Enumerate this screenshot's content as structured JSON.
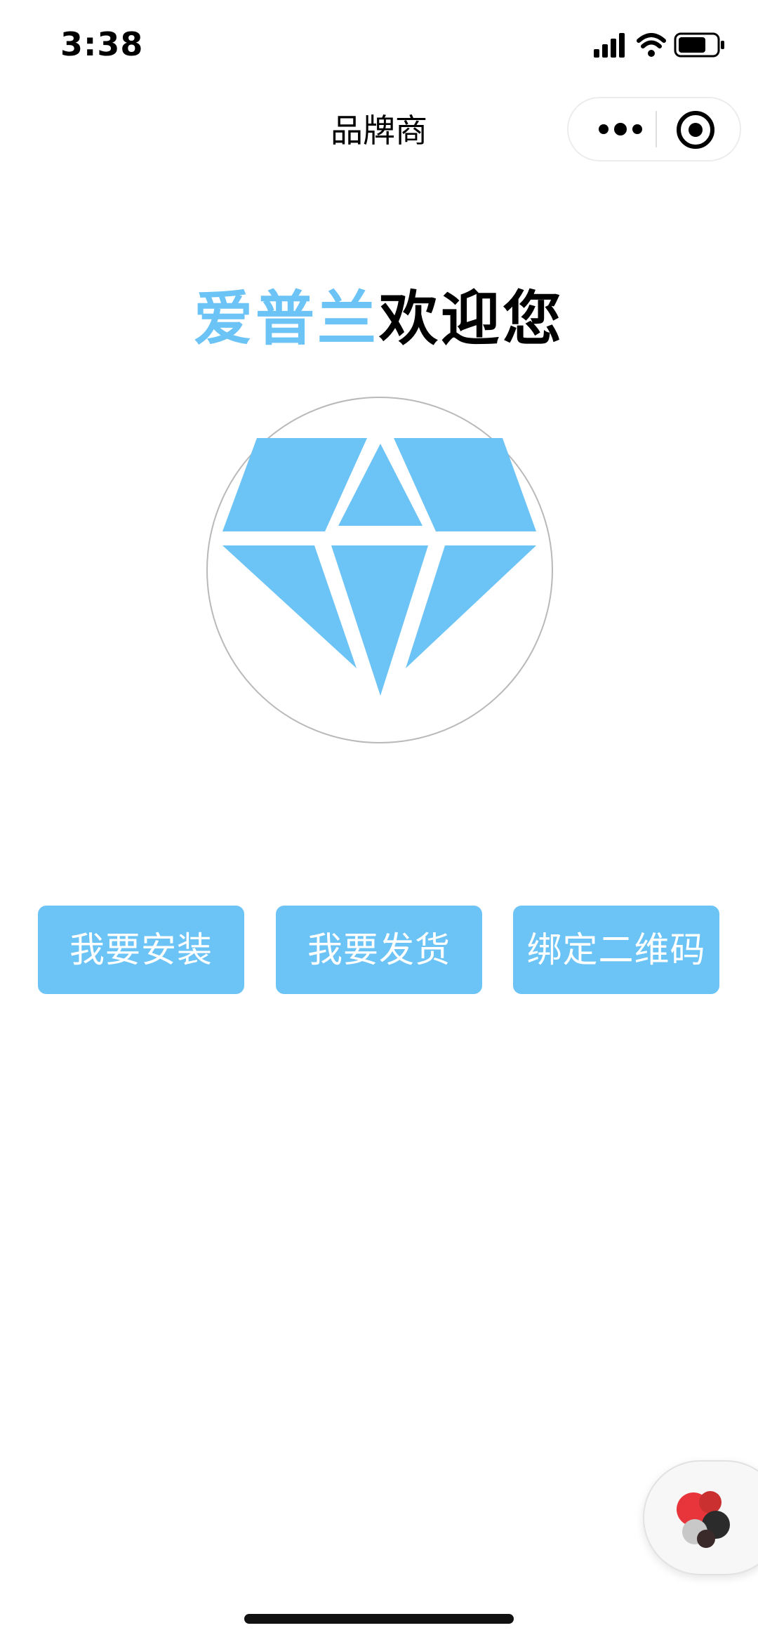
{
  "status_bar": {
    "time": "3:38",
    "icons": [
      "signal-icon",
      "wifi-icon",
      "battery-icon"
    ]
  },
  "nav": {
    "title": "品牌商",
    "capsule_icons": [
      "more-icon",
      "close-miniprogram-icon"
    ]
  },
  "welcome": {
    "brand": "爱普兰",
    "greeting": "欢迎您"
  },
  "logo": {
    "icon": "diamond-icon"
  },
  "actions": {
    "install_label": "我要安装",
    "ship_label": "我要发货",
    "bind_label": "绑定二维码"
  },
  "floating_button": {
    "icon": "assistant-icon"
  },
  "colors": {
    "accent": "#6cc3f6",
    "text": "#000000",
    "background": "#ffffff",
    "circle_border": "#b9b9b9"
  }
}
